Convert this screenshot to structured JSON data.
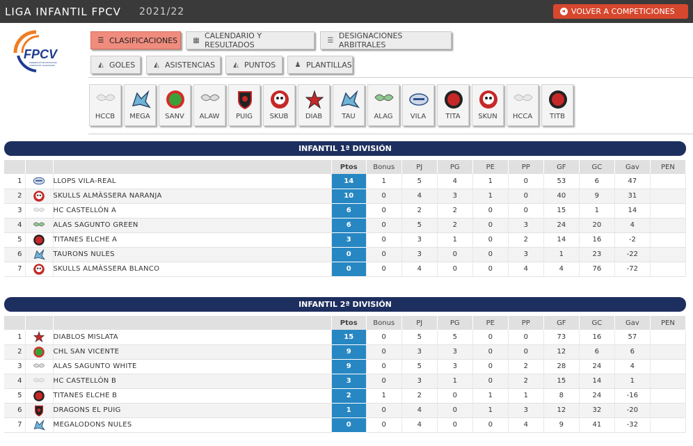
{
  "header": {
    "title": "LIGA INFANTIL FPCV",
    "season": "2021/22",
    "back_label": "VOLVER A COMPETICIONES"
  },
  "logo": {
    "text": "FPCV",
    "tagline1": "FEDERACIÓ DE PATINATGE",
    "tagline2": "COMUNITAT VALENCIANA"
  },
  "nav": {
    "clasificaciones": "CLASIFICACIONES",
    "calendario": "CALENDARIO Y RESULTADOS",
    "designaciones": "DESIGNACIONES ARBITRALES",
    "goles": "GOLES",
    "asistencias": "ASISTENCIAS",
    "puntos": "PUNTOS",
    "plantillas": "PLANTILLAS"
  },
  "teams": [
    "HCCB",
    "MEGA",
    "SANV",
    "ALAW",
    "PUIG",
    "SKUB",
    "DIAB",
    "TAU",
    "ALAG",
    "VILA",
    "TITA",
    "SKUN",
    "HCCA",
    "TITB"
  ],
  "columns": [
    "Ptos",
    "Bonus",
    "PJ",
    "PG",
    "PE",
    "PP",
    "GF",
    "GC",
    "Gav",
    "PEN"
  ],
  "divisions": [
    {
      "title": "INFANTIL 1ª DIVISIÓN",
      "rows": [
        {
          "pos": "1",
          "team": "LLOPS VILA-REAL",
          "ptos": "14",
          "bonus": "1",
          "pj": "5",
          "pg": "4",
          "pe": "1",
          "pp": "0",
          "gf": "53",
          "gc": "6",
          "gav": "47",
          "pen": ""
        },
        {
          "pos": "2",
          "team": "SKULLS ALMÀSSERA NARANJA",
          "ptos": "10",
          "bonus": "0",
          "pj": "4",
          "pg": "3",
          "pe": "1",
          "pp": "0",
          "gf": "40",
          "gc": "9",
          "gav": "31",
          "pen": ""
        },
        {
          "pos": "3",
          "team": "HC CASTELLÓN A",
          "ptos": "6",
          "bonus": "0",
          "pj": "2",
          "pg": "2",
          "pe": "0",
          "pp": "0",
          "gf": "15",
          "gc": "1",
          "gav": "14",
          "pen": ""
        },
        {
          "pos": "4",
          "team": "ALAS SAGUNTO GREEN",
          "ptos": "6",
          "bonus": "0",
          "pj": "5",
          "pg": "2",
          "pe": "0",
          "pp": "3",
          "gf": "24",
          "gc": "20",
          "gav": "4",
          "pen": ""
        },
        {
          "pos": "5",
          "team": "TITANES ELCHE A",
          "ptos": "3",
          "bonus": "0",
          "pj": "3",
          "pg": "1",
          "pe": "0",
          "pp": "2",
          "gf": "14",
          "gc": "16",
          "gav": "-2",
          "pen": ""
        },
        {
          "pos": "6",
          "team": "TAURONS NULES",
          "ptos": "0",
          "bonus": "0",
          "pj": "3",
          "pg": "0",
          "pe": "0",
          "pp": "3",
          "gf": "1",
          "gc": "23",
          "gav": "-22",
          "pen": ""
        },
        {
          "pos": "7",
          "team": "SKULLS ALMÀSSERA BLANCO",
          "ptos": "0",
          "bonus": "0",
          "pj": "4",
          "pg": "0",
          "pe": "0",
          "pp": "4",
          "gf": "4",
          "gc": "76",
          "gav": "-72",
          "pen": ""
        }
      ]
    },
    {
      "title": "INFANTIL 2ª DIVISIÓN",
      "rows": [
        {
          "pos": "1",
          "team": "DIABLOS MISLATA",
          "ptos": "15",
          "bonus": "0",
          "pj": "5",
          "pg": "5",
          "pe": "0",
          "pp": "0",
          "gf": "73",
          "gc": "16",
          "gav": "57",
          "pen": ""
        },
        {
          "pos": "2",
          "team": "CHL SAN VICENTE",
          "ptos": "9",
          "bonus": "0",
          "pj": "3",
          "pg": "3",
          "pe": "0",
          "pp": "0",
          "gf": "12",
          "gc": "6",
          "gav": "6",
          "pen": ""
        },
        {
          "pos": "3",
          "team": "ALAS SAGUNTO WHITE",
          "ptos": "9",
          "bonus": "0",
          "pj": "5",
          "pg": "3",
          "pe": "0",
          "pp": "2",
          "gf": "28",
          "gc": "24",
          "gav": "4",
          "pen": ""
        },
        {
          "pos": "4",
          "team": "HC CASTELLÓN B",
          "ptos": "3",
          "bonus": "0",
          "pj": "3",
          "pg": "1",
          "pe": "0",
          "pp": "2",
          "gf": "15",
          "gc": "14",
          "gav": "1",
          "pen": ""
        },
        {
          "pos": "5",
          "team": "TITANES ELCHE B",
          "ptos": "2",
          "bonus": "1",
          "pj": "2",
          "pg": "0",
          "pe": "1",
          "pp": "1",
          "gf": "8",
          "gc": "24",
          "gav": "-16",
          "pen": ""
        },
        {
          "pos": "6",
          "team": "DRAGONS EL PUIG",
          "ptos": "1",
          "bonus": "0",
          "pj": "4",
          "pg": "0",
          "pe": "1",
          "pp": "3",
          "gf": "12",
          "gc": "32",
          "gav": "-20",
          "pen": ""
        },
        {
          "pos": "7",
          "team": "MEGALODONS NULES",
          "ptos": "0",
          "bonus": "0",
          "pj": "4",
          "pg": "0",
          "pe": "0",
          "pp": "4",
          "gf": "9",
          "gc": "41",
          "gav": "-32",
          "pen": ""
        }
      ]
    }
  ],
  "colors": {
    "topbar": "#3a3a3a",
    "accent": "#d6472e",
    "navy": "#1d2f5e",
    "points": "#2787c2",
    "active_tab": "#f08c7e"
  }
}
